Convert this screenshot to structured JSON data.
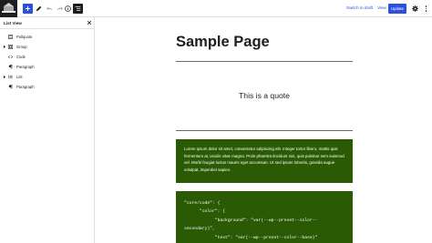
{
  "header": {
    "logo_icon": "site-logo-icon",
    "inserter_icon": "plus-icon",
    "tools_icon": "pencil-icon",
    "undo_icon": "undo-icon",
    "redo_icon": "redo-icon",
    "details_icon": "info-icon",
    "list_view_icon": "list-view-icon",
    "switch_to_draft_label": "Switch to draft",
    "preview_label": "View",
    "update_label": "Update",
    "settings_icon": "gear-icon",
    "more_icon": "more-vertical-icon",
    "accent_color": "#2b51dc"
  },
  "list_view": {
    "title": "List View",
    "close_icon": "close-icon",
    "items": [
      {
        "label": "Pullquote",
        "icon": "pullquote-icon",
        "expandable": false
      },
      {
        "label": "Group",
        "icon": "group-icon",
        "expandable": true
      },
      {
        "label": "Code",
        "icon": "code-icon",
        "expandable": false
      },
      {
        "label": "Paragraph",
        "icon": "paragraph-icon",
        "expandable": false
      },
      {
        "label": "List",
        "icon": "list-icon",
        "expandable": true
      },
      {
        "label": "Paragraph",
        "icon": "paragraph-icon",
        "expandable": false
      }
    ]
  },
  "canvas": {
    "page_title": "Sample Page",
    "quote_text": "This is a quote",
    "paragraph_text": "Lorem ipsum dolor sit amet, consectetur adipiscing elit. Integer tortor libero, mattis quis fermentum at, iaculis vitae magna. Proin pharetra tincidunt nisi, quis pulvinar sem euismod vel. Morbi feugiat luctus mauris eget accumsan. Ut sed ipsum lobortis, gravida augue volutpat, imperdiet sapien.",
    "code_text": "\"core/code\": {\n      \"color\": {\n            \"background\": \"var(--wp--preset--color--\nsecondary)\",\n            \"text\": \"var(--wp--preset--color--base)\"\n      },",
    "block_bg_color": "#2a5a04",
    "block_text_color": "#ffffff"
  }
}
